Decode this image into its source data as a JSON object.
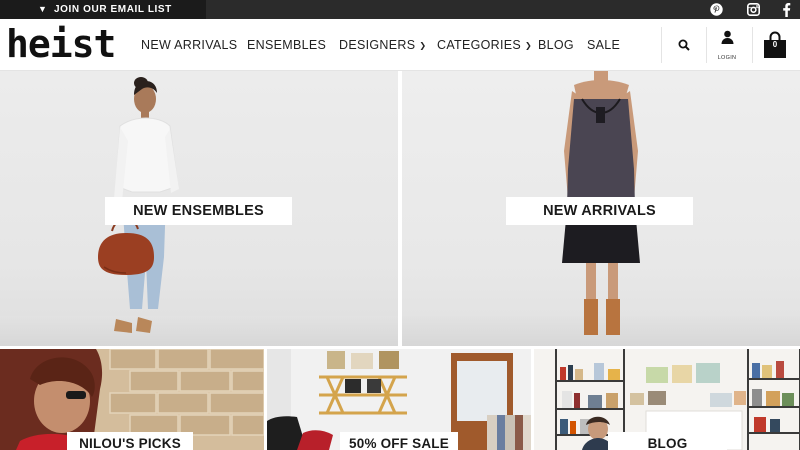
{
  "top_bar": {
    "email_cta": "JOIN OUR EMAIL LIST",
    "social": [
      "pinterest-icon",
      "instagram-icon",
      "facebook-icon"
    ]
  },
  "header": {
    "logo": "heist",
    "nav": [
      {
        "label": "NEW ARRIVALS",
        "dropdown": false
      },
      {
        "label": "ENSEMBLES",
        "dropdown": false
      },
      {
        "label": "DESIGNERS",
        "dropdown": true
      },
      {
        "label": "CATEGORIES",
        "dropdown": true
      },
      {
        "label": "BLOG",
        "dropdown": false
      },
      {
        "label": "SALE",
        "dropdown": false
      }
    ],
    "login_label": "LOGIN",
    "cart_count": "0"
  },
  "hero": {
    "left_label": "NEW ENSEMBLES",
    "right_label": "NEW ARRIVALS"
  },
  "tiles": [
    {
      "label": "NILOU'S PICKS"
    },
    {
      "label": "50% OFF SALE"
    },
    {
      "label": "BLOG"
    }
  ],
  "colors": {
    "top_bar": "#2b2b2b",
    "cta_bg": "#1b1b1b",
    "text": "#222222",
    "hero_bg": "#e8e8e8"
  }
}
